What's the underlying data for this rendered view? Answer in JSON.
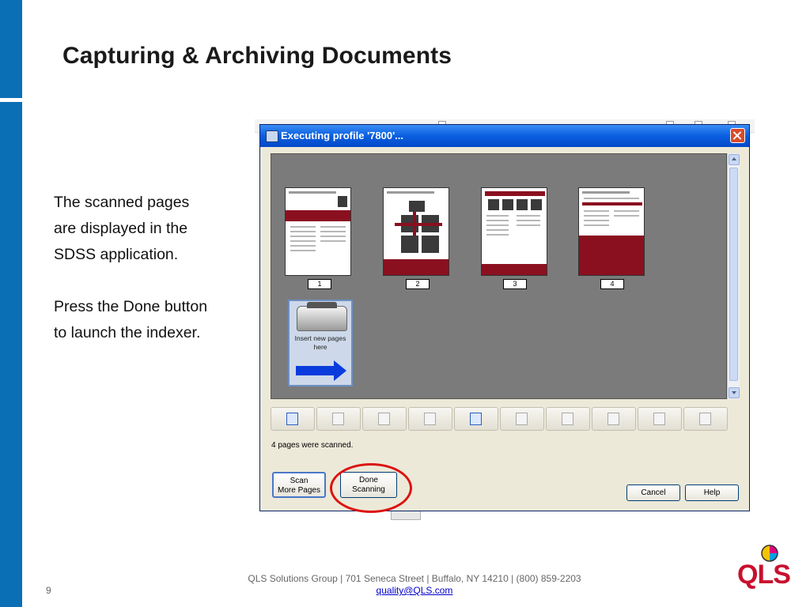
{
  "slide": {
    "title": "Capturing & Archiving Documents",
    "body_paragraph_1_lines": [
      "The scanned pages",
      "are displayed in the",
      "SDSS application."
    ],
    "body_paragraph_2_lines": [
      "Press the Done button",
      "to launch the indexer."
    ]
  },
  "dialog": {
    "title": "Executing profile '7800'...",
    "close_icon": "close-icon",
    "pages": [
      {
        "label": "1"
      },
      {
        "label": "2"
      },
      {
        "label": "3"
      },
      {
        "label": "4"
      }
    ],
    "insert_card_text_lines": [
      "Insert new pages",
      "here"
    ],
    "toolbar_icons": [
      "insert-page-icon",
      "append-page-icon",
      "rotate-left-icon",
      "rotate-right-icon",
      "undo-icon",
      "replace-icon",
      "delete-icon",
      "move-icon",
      "copy-icon",
      "delete-all-icon"
    ],
    "status": "4 pages were scanned.",
    "buttons": {
      "scan_more_lines": [
        "Scan",
        "More Pages"
      ],
      "done_scanning_lines": [
        "Done",
        "Scanning"
      ],
      "cancel": "Cancel",
      "help": "Help"
    }
  },
  "footer": {
    "address": "QLS Solutions Group | 701 Seneca Street | Buffalo, NY 14210 | (800) 859-2203",
    "email": "quality@QLS.com",
    "page_number": "9"
  },
  "logo": {
    "text": "QLS"
  },
  "colors": {
    "sidebar": "#0b6fb5",
    "highlight": "#dd1111",
    "logo_red": "#c8102e",
    "titlebar": "#0a5fe0"
  }
}
